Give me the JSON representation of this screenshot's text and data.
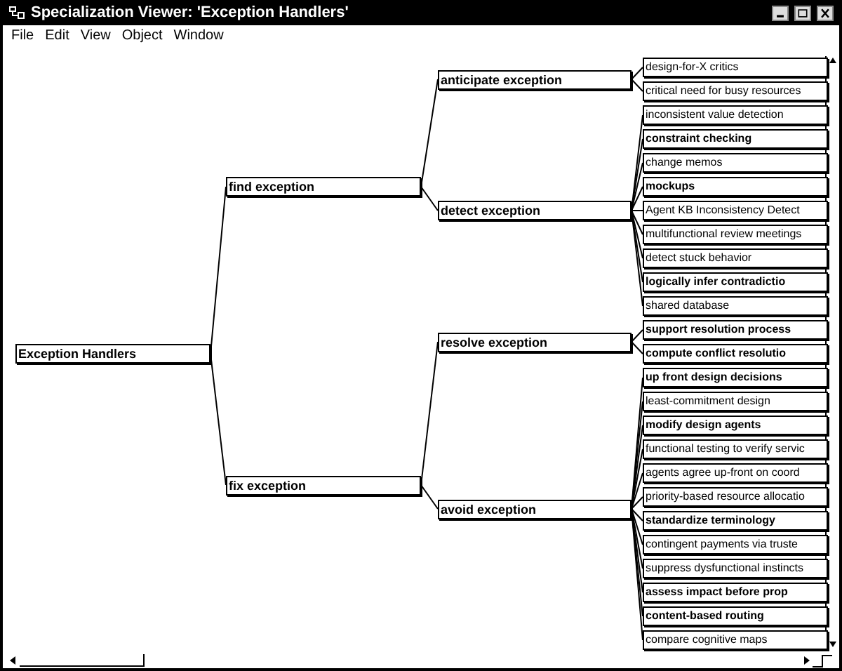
{
  "window": {
    "title": "Specialization Viewer: 'Exception Handlers'"
  },
  "menu": [
    "File",
    "Edit",
    "View",
    "Object",
    "Window"
  ],
  "tree": {
    "label": "Exception Handlers",
    "bold": true,
    "children": [
      {
        "label": "find exception",
        "bold": true,
        "children": [
          {
            "label": "anticipate exception",
            "bold": true,
            "children": [
              {
                "label": "design-for-X critics",
                "bold": false
              },
              {
                "label": "critical need for busy resources",
                "bold": false
              }
            ]
          },
          {
            "label": "detect exception",
            "bold": true,
            "children": [
              {
                "label": "inconsistent value detection",
                "bold": false
              },
              {
                "label": "constraint checking",
                "bold": true
              },
              {
                "label": "change memos",
                "bold": false
              },
              {
                "label": "mockups",
                "bold": true
              },
              {
                "label": "Agent KB Inconsistency Detect",
                "bold": false
              },
              {
                "label": "multifunctional review meetings",
                "bold": false
              },
              {
                "label": "detect stuck behavior",
                "bold": false
              },
              {
                "label": "logically infer contradictio",
                "bold": true
              },
              {
                "label": "shared database",
                "bold": false
              }
            ]
          }
        ]
      },
      {
        "label": "fix exception",
        "bold": true,
        "children": [
          {
            "label": "resolve exception",
            "bold": true,
            "children": [
              {
                "label": "support resolution process",
                "bold": true
              },
              {
                "label": "compute conflict resolutio",
                "bold": true
              }
            ]
          },
          {
            "label": "avoid exception",
            "bold": true,
            "children": [
              {
                "label": "up front design decisions",
                "bold": true
              },
              {
                "label": "least-commitment design",
                "bold": false
              },
              {
                "label": "modify design agents",
                "bold": true
              },
              {
                "label": "functional testing to verify servic",
                "bold": false
              },
              {
                "label": "agents agree up-front on coord",
                "bold": false
              },
              {
                "label": "priority-based resource allocatio",
                "bold": false
              },
              {
                "label": "standardize terminology",
                "bold": true
              },
              {
                "label": "contingent payments via truste",
                "bold": false
              },
              {
                "label": "suppress dysfunctional instincts",
                "bold": false
              },
              {
                "label": "assess impact before prop",
                "bold": true
              },
              {
                "label": "content-based routing",
                "bold": true
              },
              {
                "label": "compare cognitive maps",
                "bold": false
              }
            ]
          }
        ]
      }
    ]
  }
}
